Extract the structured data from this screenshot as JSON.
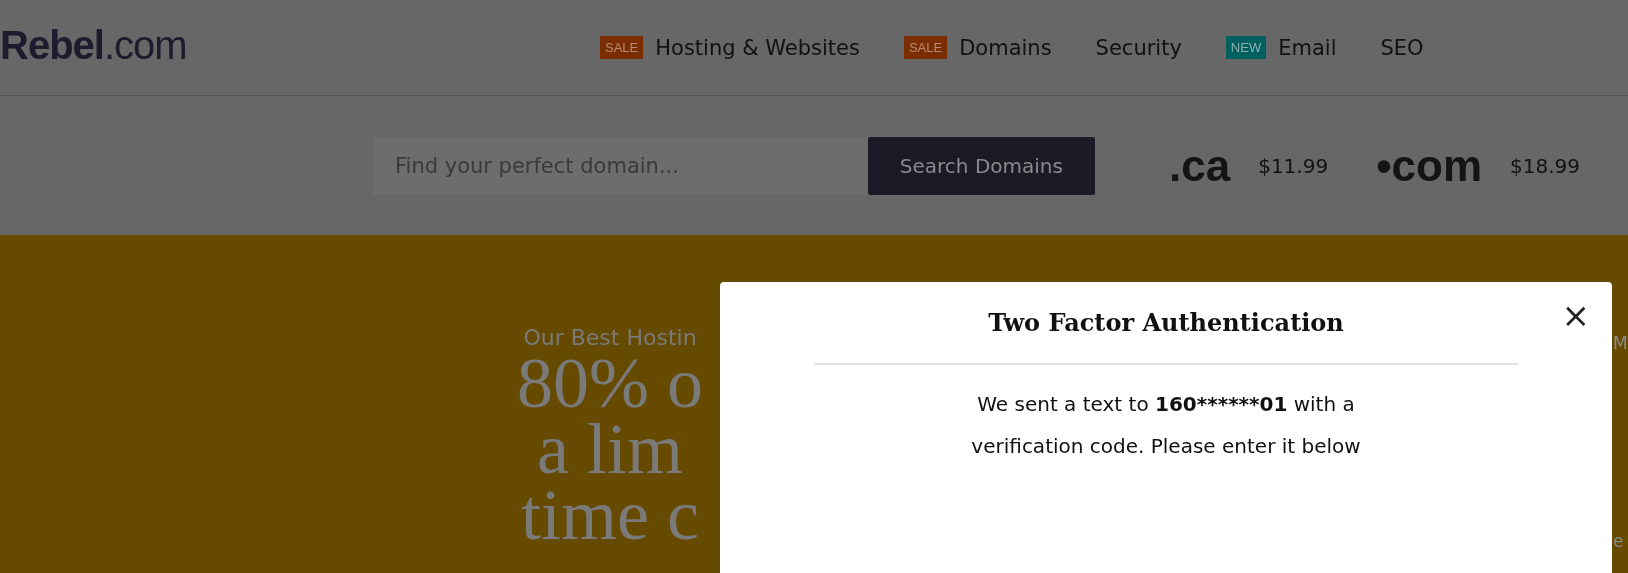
{
  "header": {
    "logo": "**Rebel**.com",
    "nav": [
      {
        "badge": "SALE",
        "kind": "sale",
        "label": "Hosting & Websites"
      },
      {
        "badge": "SALE",
        "kind": "sale",
        "label": "Domains"
      },
      {
        "kind": "plain",
        "label": "Security"
      },
      {
        "badge": "NEW",
        "kind": "new",
        "label": "Email"
      },
      {
        "kind": "plain",
        "label": "SEO"
      }
    ]
  },
  "search": {
    "placeholder": "Find your perfect domain...",
    "button": "Search Domains",
    "prices": [
      {
        "tld": ".ca",
        "price": "$11.99"
      },
      {
        "tld": "•com",
        "price": "$18.99"
      }
    ]
  },
  "hero": {
    "kicker": "Our Best Hostin",
    "headline": [
      "80% o",
      "a lim",
      "time c"
    ],
    "right_fragments": [
      "M",
      "e"
    ]
  },
  "dialog": {
    "title": "Two Factor Authentication",
    "close": "×",
    "message_parts": [
      {
        "kind": "plain",
        "text": "We sent a text to "
      },
      {
        "kind": "strong",
        "text": "160******01"
      },
      {
        "kind": "plain",
        "text": " with a verification code. Please enter it below"
      }
    ]
  }
}
